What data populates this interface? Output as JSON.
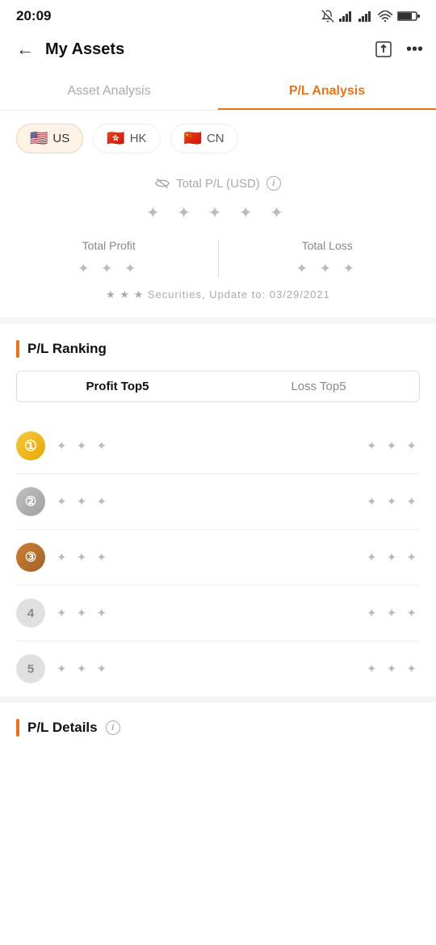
{
  "statusBar": {
    "time": "20:09",
    "icons": [
      "bell-off",
      "signal1",
      "signal2",
      "wifi",
      "battery"
    ]
  },
  "header": {
    "title": "My Assets",
    "backLabel": "←",
    "shareIcon": "⬆",
    "moreIcon": "···"
  },
  "tabs": [
    {
      "id": "asset-analysis",
      "label": "Asset Analysis",
      "active": false
    },
    {
      "id": "pl-analysis",
      "label": "P/L Analysis",
      "active": true
    }
  ],
  "markets": [
    {
      "id": "us",
      "flag": "🇺🇸",
      "label": "US",
      "active": true
    },
    {
      "id": "hk",
      "flag": "🇭🇰",
      "label": "HK",
      "active": false
    },
    {
      "id": "cn",
      "flag": "🇨🇳",
      "label": "CN",
      "active": false
    }
  ],
  "plSummary": {
    "label": "Total P/L (USD)",
    "labelIconName": "eye-hide-icon",
    "mainValue": "★ ★ ★ ★ ★",
    "totalProfit": {
      "label": "Total Profit",
      "value": "★ ★ ★"
    },
    "totalLoss": {
      "label": "Total Loss",
      "value": "★ ★ ★"
    },
    "updateText": "★ ★ ★ Securities, Update to: 03/29/2021"
  },
  "ranking": {
    "title": "P/L Ranking",
    "accentColor": "#e8731a",
    "toggle": [
      {
        "id": "profit-top5",
        "label": "Profit Top5",
        "active": true
      },
      {
        "id": "loss-top5",
        "label": "Loss Top5",
        "active": false
      }
    ],
    "items": [
      {
        "rank": 1,
        "name": "★ ★ ★",
        "value": "★ ★ ★",
        "badgeClass": "rank-1"
      },
      {
        "rank": 2,
        "name": "★ ★ ★",
        "value": "★ ★ ★",
        "badgeClass": "rank-2"
      },
      {
        "rank": 3,
        "name": "★ ★ ★",
        "value": "★ ★ ★",
        "badgeClass": "rank-3"
      },
      {
        "rank": 4,
        "name": "★ ★ ★",
        "value": "★ ★ ★",
        "badgeClass": "rank-4"
      },
      {
        "rank": 5,
        "name": "★ ★ ★",
        "value": "★ ★ ★",
        "badgeClass": "rank-5"
      }
    ]
  },
  "plDetails": {
    "title": "P/L Details"
  }
}
